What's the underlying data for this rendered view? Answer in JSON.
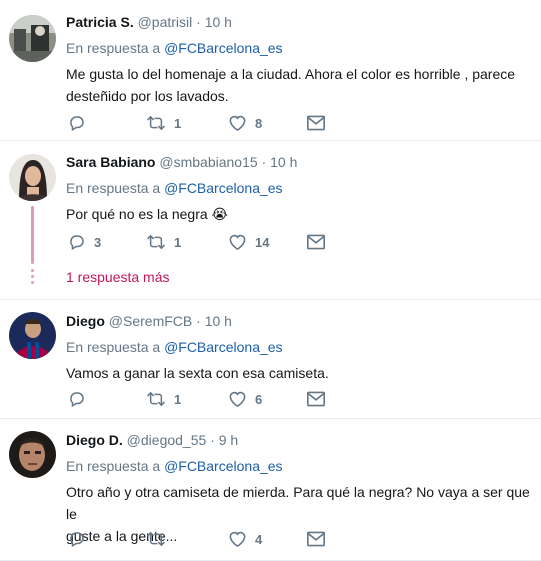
{
  "tweets": [
    {
      "name": "Patricia S.",
      "handle": "@patrisil",
      "dot": "·",
      "time": "10 h",
      "reply_prefix": "En respuesta a",
      "reply_to": "@FCBarcelona_es",
      "text_lines": [
        "Me gusta lo del homenaje a la ciudad. Ahora el color es horrible , parece",
        "desteñido por los lavados."
      ],
      "replies": "",
      "retweets": "1",
      "likes": "8"
    },
    {
      "name": "Sara Babiano",
      "handle": "@smbabiano15",
      "dot": "·",
      "time": "10 h",
      "reply_prefix": "En respuesta a",
      "reply_to": "@FCBarcelona_es",
      "text_lines": [
        "Por qué no es la negra 😭"
      ],
      "replies": "3",
      "retweets": "1",
      "likes": "14",
      "more_replies": "1 respuesta más"
    },
    {
      "name": "Diego",
      "handle": "@SeremFCB",
      "dot": "·",
      "time": "10 h",
      "reply_prefix": "En respuesta a",
      "reply_to": "@FCBarcelona_es",
      "text_lines": [
        "Vamos a ganar la sexta con esa camiseta."
      ],
      "replies": "",
      "retweets": "1",
      "likes": "6"
    },
    {
      "name": "Diego D.",
      "handle": "@diegod_55",
      "dot": "·",
      "time": "9 h",
      "reply_prefix": "En respuesta a",
      "reply_to": "@FCBarcelona_es",
      "text_lines": [
        "Otro año y otra camiseta de mierda. Para qué la negra? No vaya a ser que le",
        "guste a la gente..."
      ],
      "replies": "",
      "retweets": "",
      "likes": "4"
    }
  ],
  "icons": {
    "reply": "reply-icon",
    "retweet": "retweet-icon",
    "like": "heart-icon",
    "dm": "envelope-icon"
  },
  "colors": {
    "link": "#1d5fa8",
    "thread": "#e09bb0",
    "more": "#c2185b",
    "muted": "#657786"
  }
}
